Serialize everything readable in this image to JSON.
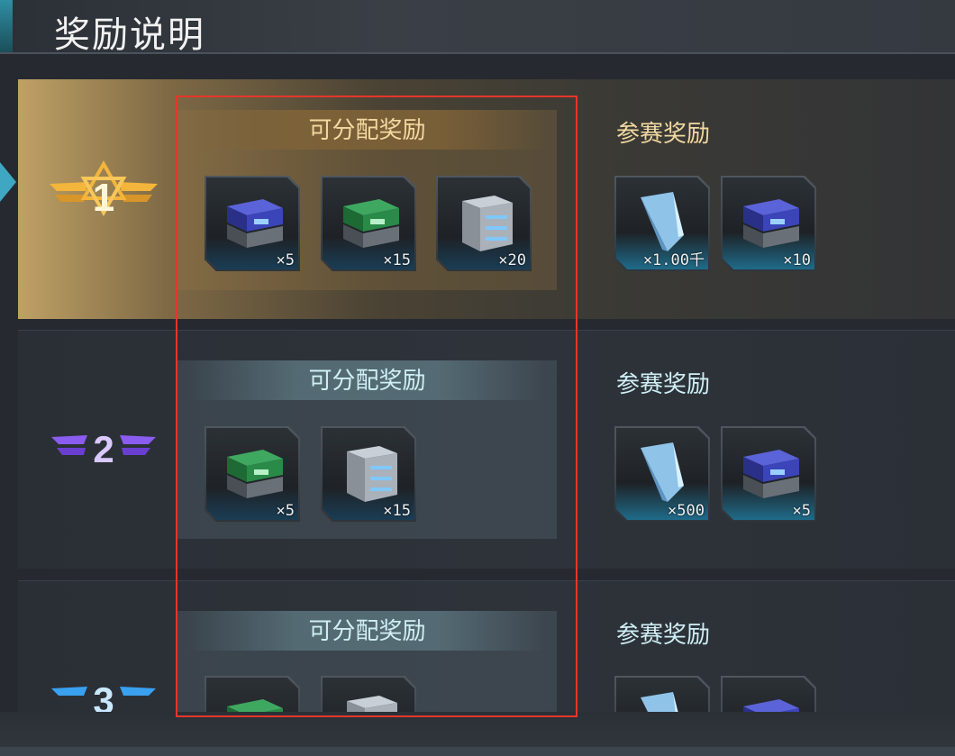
{
  "header": {
    "title": "奖励说明"
  },
  "tiers": [
    {
      "rank": "1",
      "allocatable_title": "可分配奖励",
      "participation_title": "参赛奖励",
      "allocatable_items": [
        {
          "icon": "blue-crate-icon",
          "qty": "×5"
        },
        {
          "icon": "green-crate-icon",
          "qty": "×15"
        },
        {
          "icon": "silver-crate-icon",
          "qty": "×20"
        }
      ],
      "participation_items": [
        {
          "icon": "crystal-shard-icon",
          "qty": "×1.00千"
        },
        {
          "icon": "blue-crate-icon",
          "qty": "×10"
        }
      ]
    },
    {
      "rank": "2",
      "allocatable_title": "可分配奖励",
      "participation_title": "参赛奖励",
      "allocatable_items": [
        {
          "icon": "green-crate-icon",
          "qty": "×5"
        },
        {
          "icon": "silver-crate-icon",
          "qty": "×15"
        }
      ],
      "participation_items": [
        {
          "icon": "crystal-shard-icon",
          "qty": "×500"
        },
        {
          "icon": "blue-crate-icon",
          "qty": "×5"
        }
      ]
    },
    {
      "rank": "3",
      "allocatable_title": "可分配奖励",
      "participation_title": "参赛奖励",
      "allocatable_items": [
        {
          "icon": "green-crate-icon",
          "qty": ""
        },
        {
          "icon": "silver-crate-icon",
          "qty": ""
        }
      ],
      "participation_items": [
        {
          "icon": "crystal-shard-icon",
          "qty": ""
        },
        {
          "icon": "blue-crate-icon",
          "qty": ""
        }
      ]
    }
  ],
  "colors": {
    "gold": "#f1d9a1",
    "cyan": "#cfeff5",
    "highlight_border": "#e5362b",
    "rank1": "#f3b53b",
    "rank2": "#8a5cf0",
    "rank3": "#3aa0f0"
  }
}
